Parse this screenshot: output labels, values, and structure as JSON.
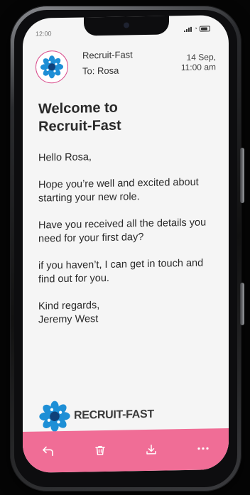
{
  "status_bar": {
    "time": "12:00"
  },
  "email": {
    "sender": "Recruit-Fast",
    "recipient": "To: Rosa",
    "date_line1": "14 Sep,",
    "date_line2": "11:00 am",
    "subject_line1": "Welcome to",
    "subject_line2": "Recruit-Fast",
    "greeting": "Hello Rosa,",
    "paragraph1": "Hope you’re well and excited about starting your new role.",
    "paragraph2": "Have you received all the details you need for your first day?",
    "paragraph3": "if you haven’t, I can get in touch and find out for you.",
    "signoff": "Kind regards,",
    "signature": "Jeremy West"
  },
  "brand": {
    "name": "RECRUIT-FAST"
  },
  "toolbar": {
    "actions": [
      {
        "icon": "reply-icon"
      },
      {
        "icon": "trash-icon"
      },
      {
        "icon": "download-icon"
      },
      {
        "icon": "more-icon"
      }
    ]
  },
  "colors": {
    "accent": "#f06d96",
    "logo_blue": "#1e8fd6",
    "logo_dark": "#10417a",
    "text": "#2a2a2a"
  }
}
